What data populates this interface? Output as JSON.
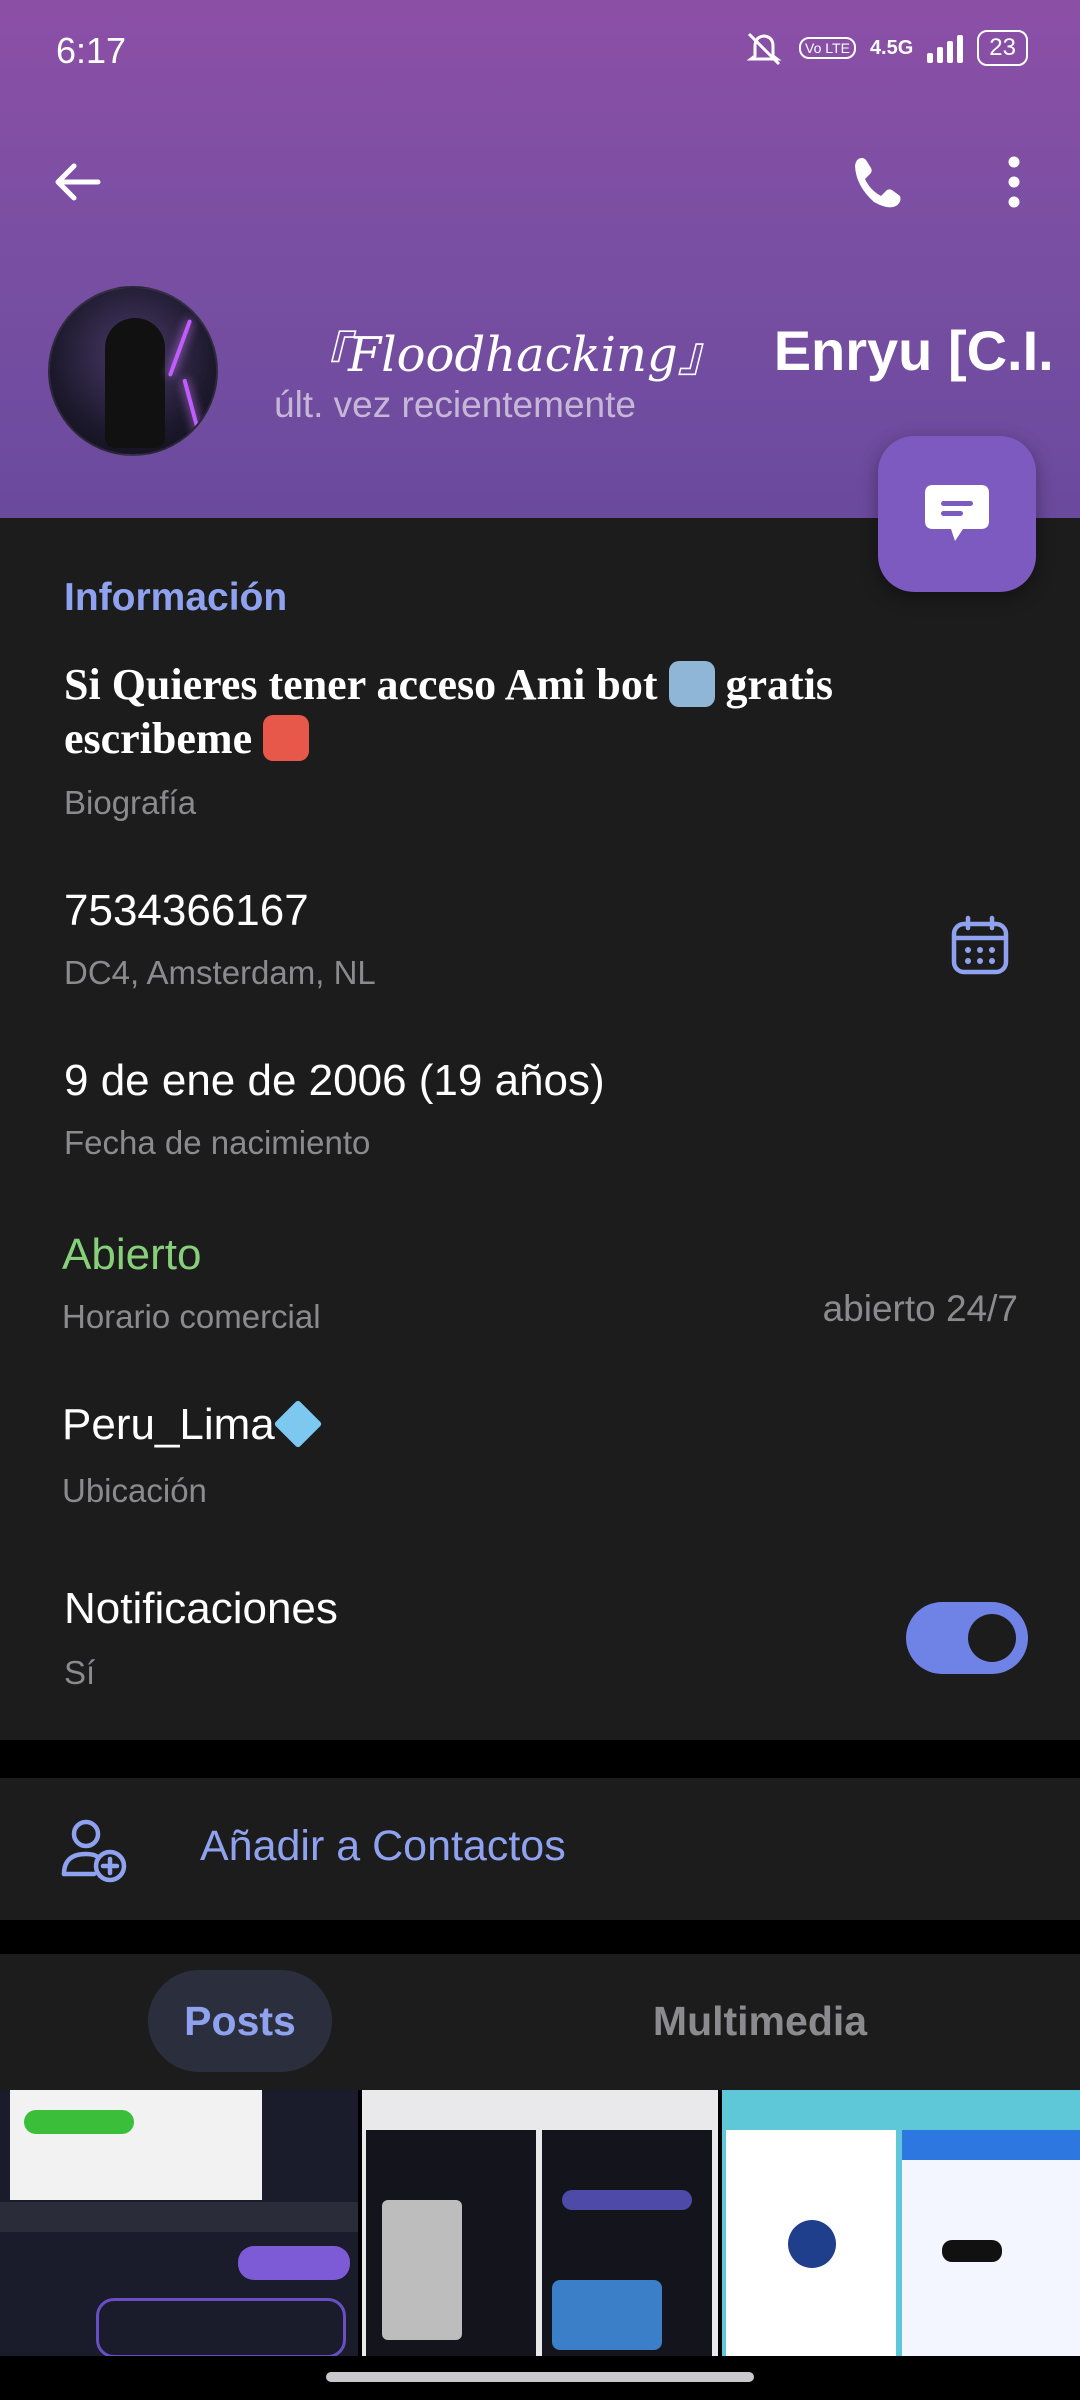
{
  "status_bar": {
    "time": "6:17",
    "network_label": "4.5G",
    "volte_label": "Vo LTE",
    "battery": "23"
  },
  "header": {
    "name_part1": "『Floodhacking』",
    "name_part2": "Enryu [C.I.",
    "last_seen": "últ. vez recientemente"
  },
  "info": {
    "section_title": "Información",
    "bio_line1": "Si Quieres tener acceso Ami bot",
    "bio_line1_end": "gratis",
    "bio_line2": "escribeme",
    "bio_label": "Biografía",
    "phone": "7534366167",
    "dc_label": "DC4, Amsterdam, NL",
    "birthday": "9 de ene de 2006 (19 años)",
    "birthday_label": "Fecha de nacimiento",
    "open_status": "Abierto",
    "hours_label": "Horario comercial",
    "hours_value": "abierto 24/7",
    "location": "Peru_Lima",
    "location_label": "Ubicación",
    "notifications": "Notificaciones",
    "notifications_value": "Sí"
  },
  "add_contact": {
    "label": "Añadir a Contactos"
  },
  "tabs": {
    "posts": "Posts",
    "media": "Multimedia"
  },
  "colors": {
    "accent": "#8fa2ef",
    "header_top": "#8c4fa6",
    "fab": "#7d5ac0",
    "open_green": "#86d07a",
    "toggle_on": "#6f82e6"
  },
  "icons": {
    "back": "back-arrow-icon",
    "call": "phone-icon",
    "menu": "more-vertical-icon",
    "message": "message-icon",
    "calendar": "calendar-icon",
    "add_contact": "add-user-icon",
    "bio_emoji_1": "robot-emoji",
    "bio_emoji_2": "gift-emoji",
    "location_emoji": "gem-emoji"
  }
}
